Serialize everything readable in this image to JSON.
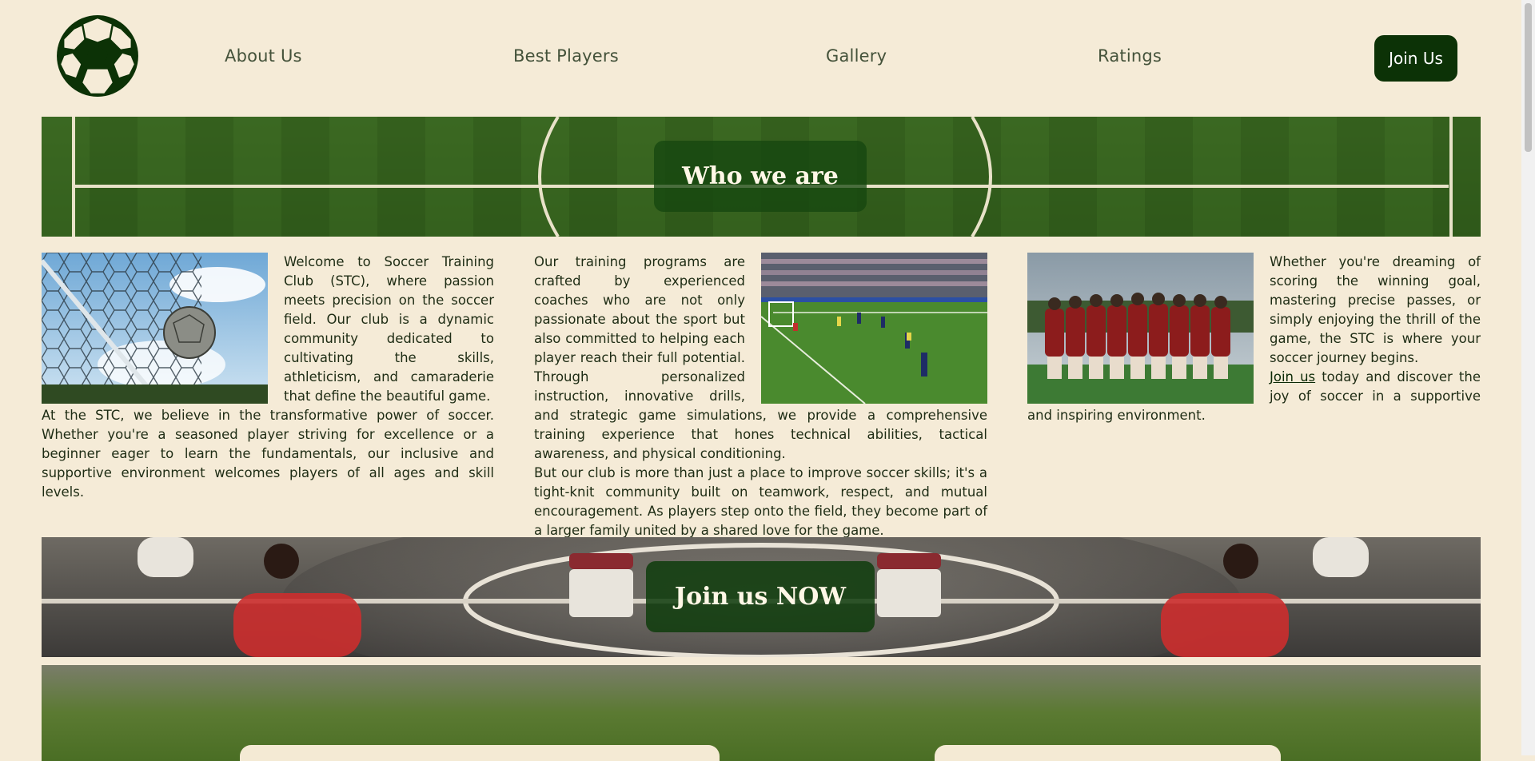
{
  "nav": {
    "logo_icon": "soccer-ball-icon",
    "links": [
      "About Us",
      "Best Players",
      "Gallery",
      "Ratings"
    ],
    "join_label": "Join Us"
  },
  "hero": {
    "title": "Who we are"
  },
  "columns": {
    "col1": {
      "p1": "Welcome to Soccer Training Club (STC), where passion meets precision on the soccer field. Our club is a dynamic community dedicated to cultivating the skills, athleticism, and camaraderie that define the beautiful game.",
      "p2": "At the STC, we believe in the transformative power of soccer. Whether you're a seasoned player striving for excellence or a beginner eager to learn the fundamentals, our inclusive and supportive environment welcomes players of all ages and skill levels."
    },
    "col2": {
      "p1": "Our training programs are crafted by experienced coaches who are not only passionate about the sport but also committed to helping each player reach their full potential. Through personalized instruction, innovative drills, and strategic game simulations, we provide a comprehensive training experience that hones technical abilities, tactical awareness, and physical conditioning.",
      "p2": "But our club is more than just a place to improve soccer skills; it's a tight-knit community built on teamwork, respect, and mutual encouragement. As players step onto the field, they become part of a larger family united by a shared love for the game."
    },
    "col3": {
      "p1": "Whether you're dreaming of scoring the winning goal, mastering precise passes, or simply enjoying the thrill of the game, the STC is where your soccer journey begins.",
      "link": "Join us",
      "p2_rest": " today and discover the joy of soccer in a supportive and inspiring environment."
    }
  },
  "cta": {
    "title": "Join us NOW"
  },
  "colors": {
    "brand_green": "#0c3206",
    "background": "#f5ebd7",
    "text": "#1e2c14"
  }
}
